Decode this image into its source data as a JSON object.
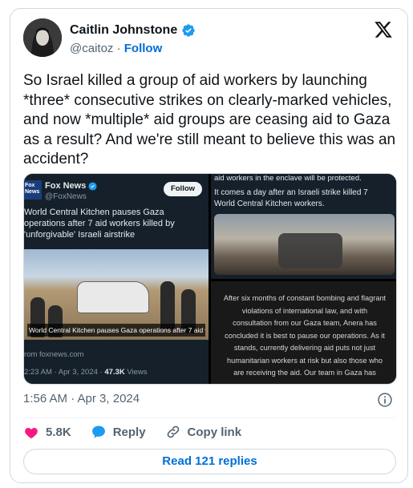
{
  "author": {
    "name": "Caitlin Johnstone",
    "handle": "@caitoz",
    "separator": "·",
    "follow_label": "Follow"
  },
  "tweet": {
    "text": "So Israel killed a group of aid workers by launching *three* consecutive strikes on clearly-marked vehicles, and now *multiple* aid groups are ceasing aid to Gaza as a result? And we're still meant to believe this was an accident?",
    "timestamp": "1:56 AM · Apr 3, 2024"
  },
  "media": {
    "fox_logo": "Fox News",
    "fox_name": "Fox News",
    "fox_handle": "@FoxNews",
    "fox_follow": "Follow",
    "fox_headline": "World Central Kitchen pauses Gaza operations after 7 aid workers killed by 'unforgivable' Israeli airstrike",
    "photo_caption": "World Central Kitchen pauses Gaza operations after 7 aid w...",
    "source": "rom foxnews.com",
    "meta_time": "2:23 AM · Apr 3, 2024 · ",
    "meta_views": "47.3K",
    "meta_views_label": " Views",
    "right_top_line1": "aid workers in the enclave will be protected.",
    "right_top_line2": "It comes a day after an Israeli strike killed 7 World Central Kitchen workers.",
    "right_bottom_text": "After six months of constant bombing and flagrant violations of international law, and with consultation from our Gaza team, Anera has concluded it is best to pause our operations. As it stands, currently delivering aid puts not just humanitarian workers at risk but also those who are receiving the aid. Our team in Gaza has"
  },
  "actions": {
    "likes": "5.8K",
    "reply_label": "Reply",
    "copy_link_label": "Copy link",
    "read_replies_label": "Read 121 replies"
  },
  "colors": {
    "accent": "#006fd6",
    "like": "#f91880",
    "verified": "#1d9bf0"
  }
}
